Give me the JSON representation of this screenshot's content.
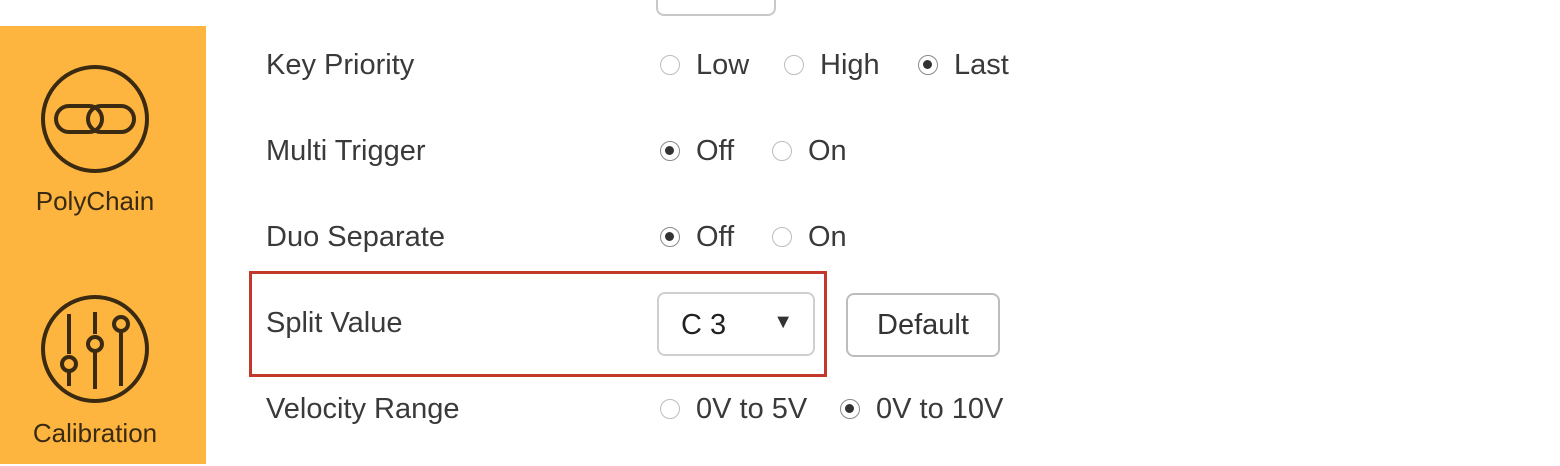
{
  "sidebar": {
    "items": [
      {
        "label": "PolyChain",
        "icon": "chain-link-icon"
      },
      {
        "label": "Calibration",
        "icon": "sliders-icon"
      }
    ]
  },
  "settings": {
    "key_priority": {
      "label": "Key Priority",
      "options": [
        "Low",
        "High",
        "Last"
      ],
      "selected": "Last"
    },
    "multi_trigger": {
      "label": "Multi Trigger",
      "options": [
        "Off",
        "On"
      ],
      "selected": "Off"
    },
    "duo_separate": {
      "label": "Duo Separate",
      "options": [
        "Off",
        "On"
      ],
      "selected": "Off"
    },
    "split_value": {
      "label": "Split Value",
      "value": "C 3",
      "default_label": "Default"
    },
    "velocity_range": {
      "label": "Velocity Range",
      "options": [
        "0V to 5V",
        "0V to 10V"
      ],
      "selected": "0V to 10V"
    }
  },
  "colors": {
    "sidebar": "#FDB53F",
    "highlight": "#C0392B"
  }
}
